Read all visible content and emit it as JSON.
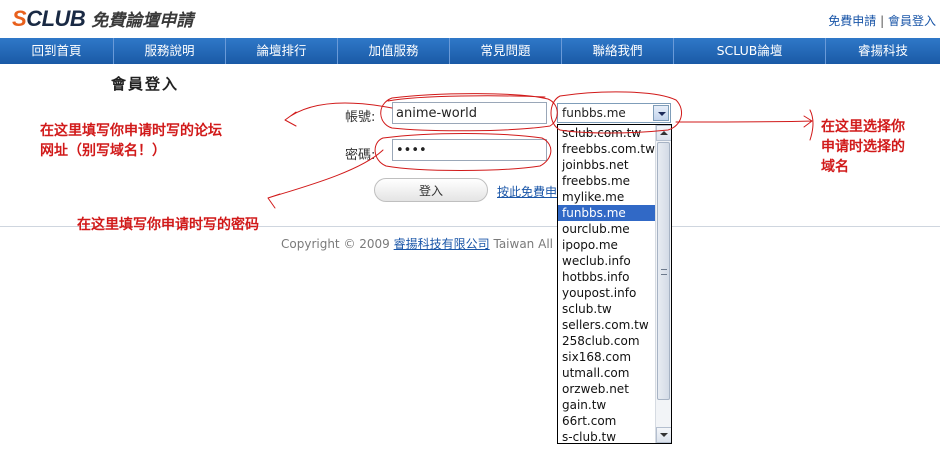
{
  "header": {
    "logo_brand_s": "S",
    "logo_brand_rest": "CLUB",
    "logo_sub": "免費論壇申請",
    "link_register": "免費申請",
    "separator": "|",
    "link_login": "會員登入"
  },
  "nav": [
    "回到首頁",
    "服務說明",
    "論壇排行",
    "加值服務",
    "常見問題",
    "聯絡我們",
    "SCLUB論壇",
    "睿揚科技"
  ],
  "form": {
    "title": "會員登入",
    "account_label": "帳號:",
    "account_value": "anime-world",
    "password_label": "密碼:",
    "password_value": "••••",
    "domain_selected": "funbbs.me",
    "login_button": "登入",
    "register_link": "按此免費申"
  },
  "dropdown": {
    "options": [
      "sclub.com.tw",
      "freebbs.com.tw",
      "joinbbs.net",
      "freebbs.me",
      "mylike.me",
      "funbbs.me",
      "ourclub.me",
      "ipopo.me",
      "weclub.info",
      "hotbbs.info",
      "youpost.info",
      "sclub.tw",
      "sellers.com.tw",
      "258club.com",
      "six168.com",
      "utmall.com",
      "orzweb.net",
      "gain.tw",
      "66rt.com",
      "s-club.tw"
    ],
    "selected_index": 5
  },
  "footer": {
    "copyright_prefix": "Copyright © 2009",
    "company": "睿揚科技有限公司",
    "copyright_suffix": "Taiwan All"
  },
  "annotations": {
    "account_note_line1": "在这里填写你申请时写的论坛",
    "account_note_line2": "网址（别写域名！）",
    "password_note": "在这里填写你申请时写的密码",
    "domain_note_line1": "在这里选择你",
    "domain_note_line2": "申请时选择的",
    "domain_note_line3": "域名"
  },
  "colors": {
    "nav_bg": "#1a5aa6",
    "annotation_red": "#d11a1a",
    "logo_orange": "#e8601c",
    "selected_option": "#3169c6"
  }
}
